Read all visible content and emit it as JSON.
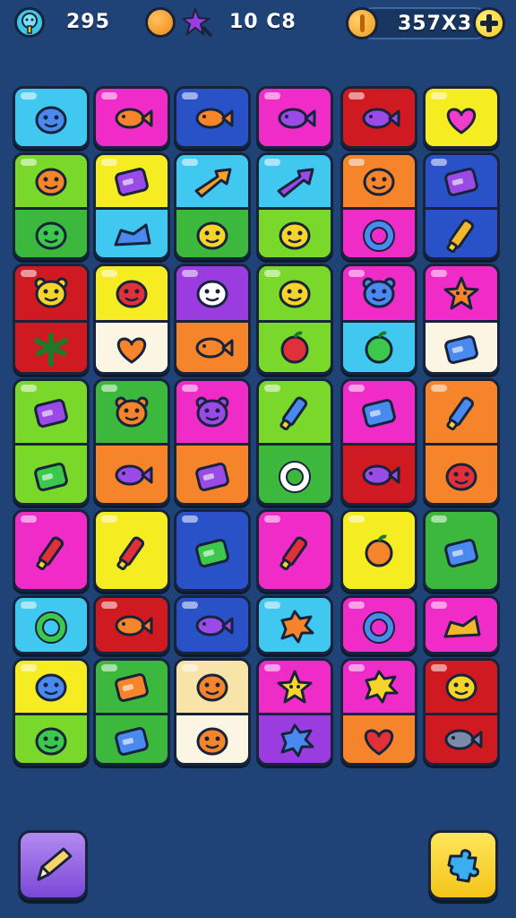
{
  "hud": {
    "lives": "295",
    "moves": "10 C8",
    "coins": "357X3"
  },
  "colors": {
    "background": "#1f4377",
    "cyan": "#41c8f0",
    "magenta": "#f02cc8",
    "blue": "#2a52c8",
    "red": "#d01a22",
    "yellow": "#f6ec22",
    "lime": "#7ad82a",
    "green": "#3cb83c",
    "orange": "#f6842a",
    "purple": "#9a3ce0",
    "white": "#fbf5e4",
    "cream": "#f8e3a8"
  },
  "tiles": [
    {
      "colors": [
        "cyan"
      ],
      "icons": [
        "blue-blob-creature-icon"
      ]
    },
    {
      "colors": [
        "magenta"
      ],
      "icons": [
        "orange-fish-icon"
      ]
    },
    {
      "colors": [
        "blue"
      ],
      "icons": [
        "orange-fish-icon"
      ]
    },
    {
      "colors": [
        "magenta"
      ],
      "icons": [
        "purple-fish-icon"
      ]
    },
    {
      "colors": [
        "red"
      ],
      "icons": [
        "purple-fish-icon"
      ]
    },
    {
      "colors": [
        "yellow"
      ],
      "icons": [
        "magenta-heart-icon"
      ]
    },
    {
      "colors": [
        "lime",
        "green"
      ],
      "icons": [
        "orange-spiky-creature-icon",
        "green-bug-creature-icon"
      ]
    },
    {
      "colors": [
        "yellow",
        "cyan"
      ],
      "icons": [
        "purple-candy-icon",
        "blue-shoe-icon"
      ]
    },
    {
      "colors": [
        "cyan",
        "green"
      ],
      "icons": [
        "bow-arrow-icon",
        "yellow-goblin-face-icon"
      ]
    },
    {
      "colors": [
        "cyan",
        "lime"
      ],
      "icons": [
        "purple-arrow-icon",
        "yellow-blob-creature-icon"
      ]
    },
    {
      "colors": [
        "orange",
        "magenta"
      ],
      "icons": [
        "orange-blob-creature-icon",
        "blue-ring-icon"
      ]
    },
    {
      "colors": [
        "blue",
        "blue"
      ],
      "icons": [
        "purple-box-icon",
        "gold-brush-icon"
      ]
    },
    {
      "colors": [
        "red",
        "red"
      ],
      "icons": [
        "yellow-cat-face-icon",
        "green-palm-icon"
      ]
    },
    {
      "colors": [
        "yellow",
        "white"
      ],
      "icons": [
        "red-blob-creature-icon",
        "orange-heart-bubble-icon"
      ]
    },
    {
      "colors": [
        "purple",
        "orange"
      ],
      "icons": [
        "white-cloud-creature-icon",
        "orange-fish-icon"
      ]
    },
    {
      "colors": [
        "lime",
        "lime"
      ],
      "icons": [
        "yellow-blob-creature-icon",
        "red-apple-icon"
      ]
    },
    {
      "colors": [
        "magenta",
        "cyan"
      ],
      "icons": [
        "blue-cat-face-icon",
        "green-shell-icon"
      ]
    },
    {
      "colors": [
        "magenta",
        "white"
      ],
      "icons": [
        "orange-star-creature-icon",
        "blue-box-icon"
      ]
    },
    {
      "colors": [
        "lime",
        "lime"
      ],
      "icons": [
        "purple-machine-icon",
        "green-basket-icon"
      ]
    },
    {
      "colors": [
        "green",
        "orange"
      ],
      "icons": [
        "orange-bear-icon",
        "purple-fish-icon"
      ]
    },
    {
      "colors": [
        "magenta",
        "orange"
      ],
      "icons": [
        "purple-bear-icon",
        "purple-camera-icon"
      ]
    },
    {
      "colors": [
        "lime",
        "green"
      ],
      "icons": [
        "blue-bottle-icon",
        "white-ring-icon"
      ]
    },
    {
      "colors": [
        "magenta",
        "red"
      ],
      "icons": [
        "blue-bandage-icon",
        "purple-fish-icon"
      ]
    },
    {
      "colors": [
        "orange",
        "orange"
      ],
      "icons": [
        "blue-hook-icon",
        "red-blob-creature-icon"
      ]
    },
    {
      "colors": [
        "magenta"
      ],
      "icons": [
        "red-popsicle-icon"
      ]
    },
    {
      "colors": [
        "yellow"
      ],
      "icons": [
        "red-hammer-icon"
      ]
    },
    {
      "colors": [
        "blue"
      ],
      "icons": [
        "green-battery-icon"
      ]
    },
    {
      "colors": [
        "magenta"
      ],
      "icons": [
        "red-crayon-icon"
      ]
    },
    {
      "colors": [
        "yellow"
      ],
      "icons": [
        "orange-balloon-face-icon"
      ]
    },
    {
      "colors": [
        "green"
      ],
      "icons": [
        "blue-battery-icon"
      ]
    },
    {
      "colors": [
        "cyan"
      ],
      "icons": [
        "green-ring-icon"
      ]
    },
    {
      "colors": [
        "red"
      ],
      "icons": [
        "orange-fish-icon"
      ]
    },
    {
      "colors": [
        "blue"
      ],
      "icons": [
        "purple-fish-icon"
      ]
    },
    {
      "colors": [
        "cyan"
      ],
      "icons": [
        "orange-splat-icon"
      ]
    },
    {
      "colors": [
        "magenta"
      ],
      "icons": [
        "blue-ring-icon"
      ]
    },
    {
      "colors": [
        "magenta"
      ],
      "icons": [
        "gold-cheese-icon"
      ]
    },
    {
      "colors": [
        "yellow",
        "lime"
      ],
      "icons": [
        "blue-blob-creature-icon",
        "green-blob-creature-icon"
      ]
    },
    {
      "colors": [
        "green",
        "green"
      ],
      "icons": [
        "orange-candy-icon",
        "blue-candy-icon"
      ]
    },
    {
      "colors": [
        "cream",
        "white"
      ],
      "icons": [
        "orange-blob-creature-icon",
        "orange-blob-creature-icon"
      ]
    },
    {
      "colors": [
        "magenta",
        "purple"
      ],
      "icons": [
        "yellow-star-icon",
        "blue-splat-icon"
      ]
    },
    {
      "colors": [
        "magenta",
        "orange"
      ],
      "icons": [
        "yellow-splat-icon",
        "red-heart-icon"
      ]
    },
    {
      "colors": [
        "red",
        "red"
      ],
      "icons": [
        "yellow-blob-creature-icon",
        "gray-fish-icon"
      ]
    }
  ],
  "buttons": {
    "left": {
      "icon": "pencil-icon"
    },
    "right": {
      "icon": "puzzle-piece-icon"
    }
  }
}
